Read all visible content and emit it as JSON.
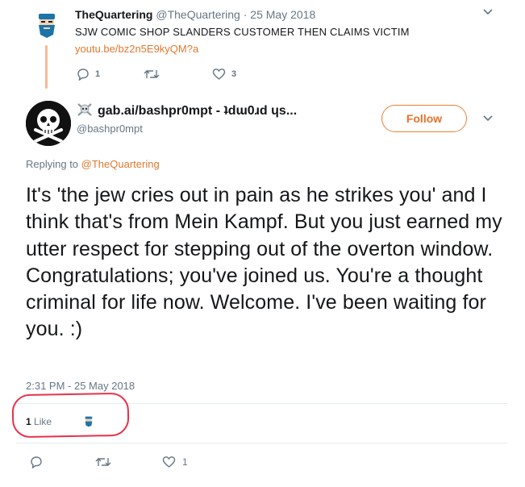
{
  "parent_tweet": {
    "name": "TheQuartering",
    "handle": "@TheQuartering · 25 May 2018",
    "text": "SJW COMIC SHOP SLANDERS CUSTOMER THEN CLAIMS VICTIM",
    "link": "youtu.be/bz2n5E9kyQM?a",
    "reply_count": "1",
    "like_count": "3"
  },
  "reply_tweet": {
    "name": "gab.ai/bashpr0mpt - ʇdɯ0ɹd ɥs...",
    "handle": "@bashpr0mpt",
    "follow_label": "Follow",
    "replying_prefix": "Replying to ",
    "replying_to": "@TheQuartering",
    "text": "It's 'the jew cries out in pain as he strikes you' and I think that's from Mein Kampf. But you just earned my utter respect for stepping out of the overton window. Congratulations; you've joined us. You're a thought criminal for life now. Welcome. I've been waiting for you. :)",
    "timestamp": "2:31 PM - 25 May 2018",
    "likes_number": "1",
    "likes_label": "Like",
    "like_count": "1"
  },
  "colors": {
    "accent": "#e8732a",
    "annotation": "#e8314a",
    "muted": "#657786"
  }
}
